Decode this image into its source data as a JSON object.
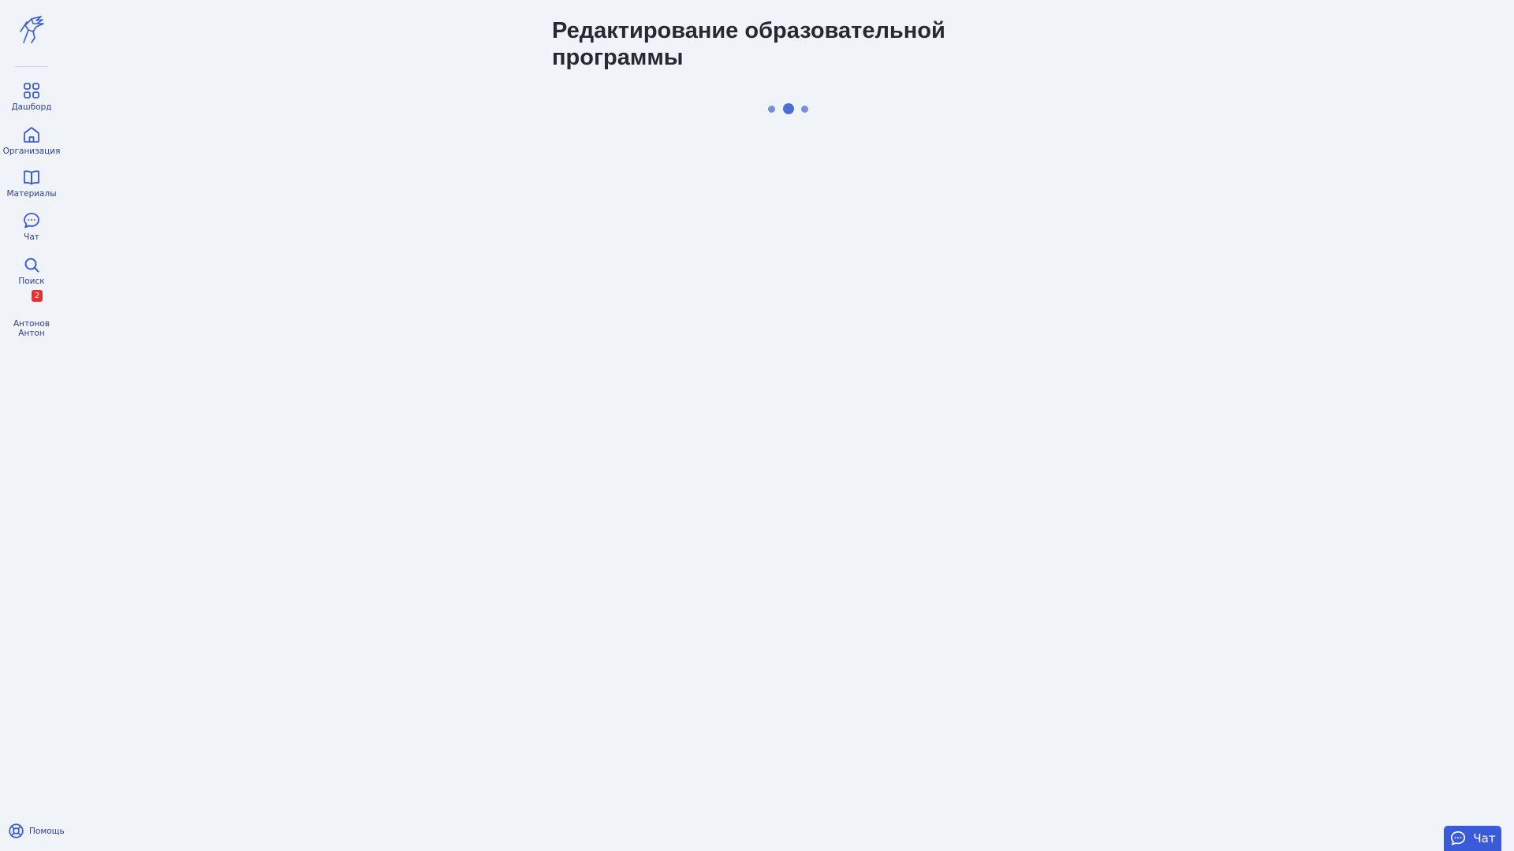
{
  "page": {
    "title": "Редактирование образовательной программы"
  },
  "sidebar": {
    "logo_icon": "hunter-logo-icon",
    "items": [
      {
        "label": "Дашборд",
        "icon": "grid-icon"
      },
      {
        "label": "Организация",
        "icon": "home-icon"
      },
      {
        "label": "Материалы",
        "icon": "book-icon"
      },
      {
        "label": "Чат",
        "icon": "chat-bubble-icon"
      },
      {
        "label": "Поиск",
        "icon": "search-icon"
      }
    ],
    "profile": {
      "name": "Антонов Антон",
      "badge_count": "2"
    },
    "help_label": "Помощь"
  },
  "loader": {
    "dots": 3
  },
  "chat_widget": {
    "label": "Чат",
    "icon": "chat-bubble-icon"
  },
  "colors": {
    "background": "#f0f4f8",
    "accent": "#3a5bd9",
    "nav_text": "#2e3f8f",
    "badge": "#e5322e",
    "title": "#242a33"
  }
}
